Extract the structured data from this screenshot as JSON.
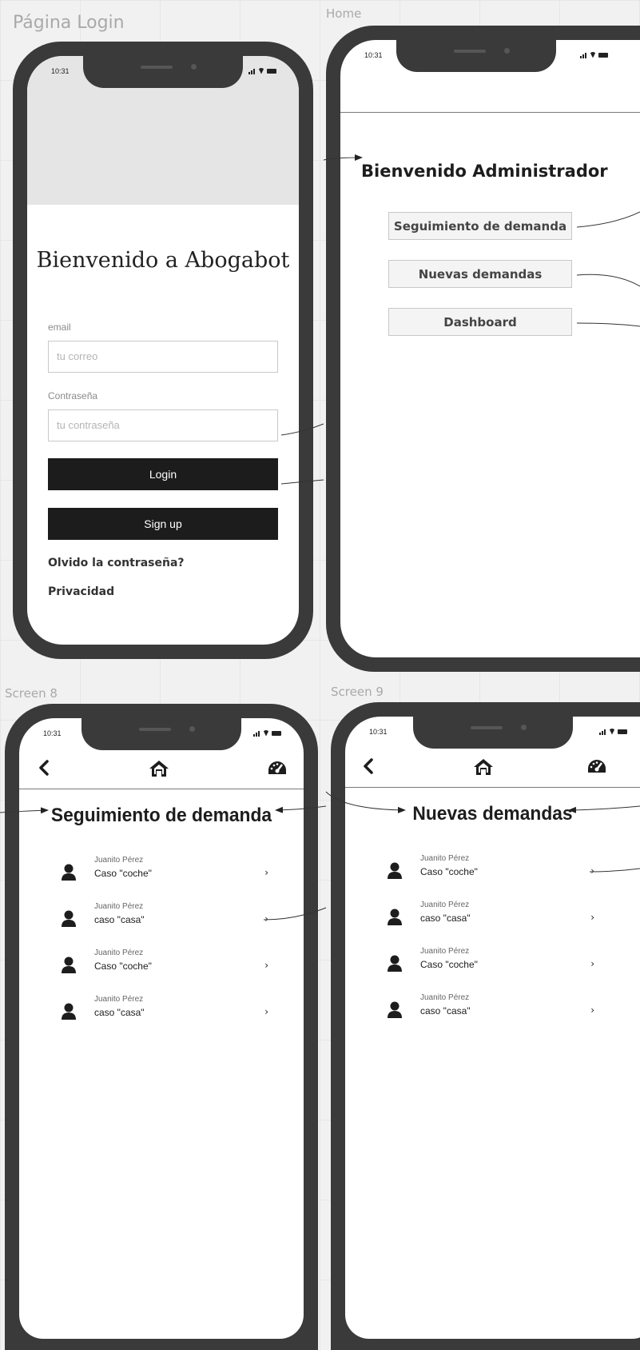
{
  "boards": {
    "login_label": "Página Login",
    "home_label": "Home",
    "screen8_label": "Screen 8",
    "screen9_label": "Screen 9"
  },
  "status_bar": {
    "time": "10:31"
  },
  "login": {
    "title": "Bienvenido a Abogabot",
    "email_label": "email",
    "email_placeholder": "tu correo",
    "password_label": "Contraseña",
    "password_placeholder": "tu contraseña",
    "login_button": "Login",
    "signup_button": "Sign up",
    "forgot_link": "Olvido la contraseña?",
    "privacy_link": "Privacidad"
  },
  "home": {
    "title": "Bienvenido Administrador",
    "buttons": [
      "Seguimiento de demanda",
      "Nuevas demandas",
      "Dashboard"
    ]
  },
  "screen8": {
    "title": "Seguimiento de demanda",
    "items": [
      {
        "name": "Juanito Pérez",
        "case": "Caso \"coche\""
      },
      {
        "name": "Juanito Pérez",
        "case": "caso \"casa\""
      },
      {
        "name": "Juanito Pérez",
        "case": "Caso \"coche\""
      },
      {
        "name": "Juanito Pérez",
        "case": "caso \"casa\""
      }
    ]
  },
  "screen9": {
    "title": "Nuevas demandas",
    "items": [
      {
        "name": "Juanito Pérez",
        "case": "Caso \"coche\""
      },
      {
        "name": "Juanito Pérez",
        "case": "caso \"casa\""
      },
      {
        "name": "Juanito Pérez",
        "case": "Caso \"coche\""
      },
      {
        "name": "Juanito Pérez",
        "case": "caso \"casa\""
      }
    ]
  },
  "icons": {
    "back": "back-chevron-icon",
    "home": "home-icon",
    "dashboard": "speedometer-icon",
    "person": "person-icon",
    "chevron": "chevron-right-icon"
  }
}
